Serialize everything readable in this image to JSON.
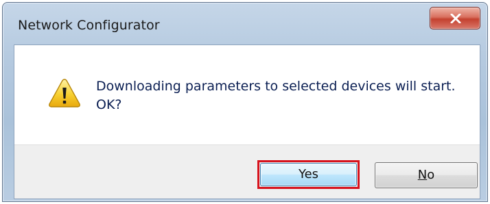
{
  "window": {
    "title": "Network Configurator",
    "close_icon": "close-icon"
  },
  "dialog": {
    "icon": "warning-icon",
    "message_line1": "Downloading parameters to selected devices will start.",
    "message_line2": "OK?"
  },
  "buttons": {
    "yes_label": "Yes",
    "no_mnemonic": "N",
    "no_rest": "o"
  },
  "colors": {
    "highlight_border": "#d7121c",
    "message_text": "#0a1e52",
    "close_button": "#c4412f"
  }
}
